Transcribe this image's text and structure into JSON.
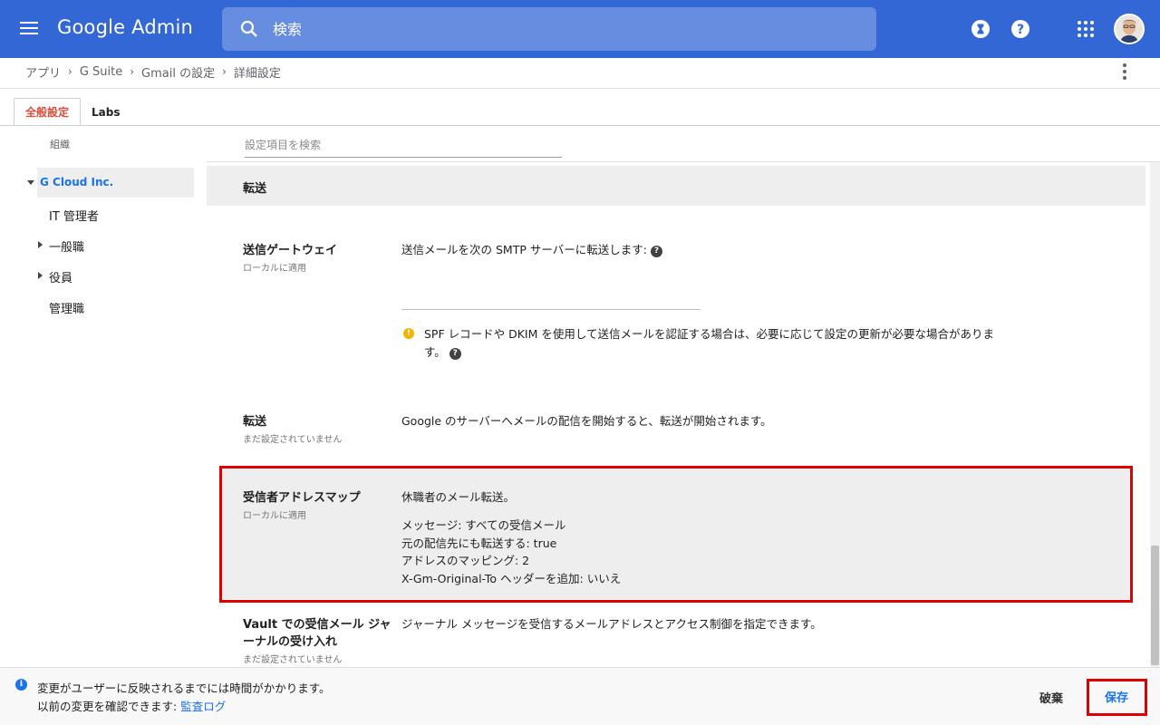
{
  "app": {
    "title": "Google Admin"
  },
  "search": {
    "placeholder": "検索"
  },
  "topbar": {
    "icons": [
      "menu-icon",
      "search-icon",
      "hourglass-icon",
      "help-icon",
      "apps-grid-icon",
      "avatar"
    ]
  },
  "breadcrumb": [
    "アプリ",
    "G Suite",
    "Gmail の設定",
    "詳細設定"
  ],
  "tabs": [
    {
      "label": "全般設定",
      "active": true
    },
    {
      "label": "Labs",
      "active": false
    }
  ],
  "sidebar": {
    "org_label": "組織",
    "root": "G Cloud Inc.",
    "items": [
      {
        "label": "IT 管理者",
        "expandable": false
      },
      {
        "label": "一般職",
        "expandable": true
      },
      {
        "label": "役員",
        "expandable": true
      },
      {
        "label": "管理職",
        "expandable": false
      }
    ]
  },
  "settings_search": {
    "placeholder": "設定項目を検索"
  },
  "section": {
    "title": "転送"
  },
  "settings": {
    "gateway": {
      "title": "送信ゲートウェイ",
      "sub": "ローカルに適用",
      "text": "送信メールを次の SMTP サーバーに転送します:",
      "smtp_value": "",
      "warning": "SPF レコードや DKIM を使用して送信メールを認証する場合は、必要に応じて設定の更新が必要な場合があります。"
    },
    "forwarding": {
      "title": "転送",
      "sub": "まだ設定されていません",
      "text": "Google のサーバーへメールの配信を開始すると、転送が開始されます。"
    },
    "recipient_map": {
      "title": "受信者アドレスマップ",
      "sub": "ローカルに適用",
      "desc": "休職者のメール転送。",
      "details": [
        "メッセージ:  すべての受信メール",
        "元の配信先にも転送する:  true",
        "アドレスのマッピング:  2",
        "X-Gm-Original-To ヘッダーを追加:  いいえ"
      ]
    },
    "vault": {
      "title_line1": "Vault での受信メール ジャ",
      "title_line2": "ーナルの受け入れ",
      "sub": "まだ設定されていません",
      "text": "ジャーナル メッセージを受信するメールアドレスとアクセス制御を指定できます。"
    }
  },
  "bottom": {
    "notice1": "変更がユーザーに反映されるまでには時間がかかります。",
    "notice2_prefix": "以前の変更を確認できます: ",
    "notice2_link": "監査ログ",
    "discard": "破棄",
    "save": "保存"
  },
  "colors": {
    "topbar": "#3367d6",
    "accent": "#1a73e8",
    "tab_active": "#dd4b39",
    "highlight_border": "#e00000",
    "warning": "#f4b400"
  }
}
